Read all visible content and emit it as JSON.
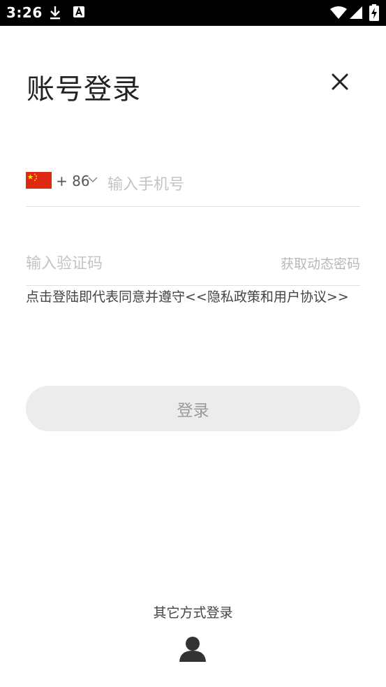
{
  "status_bar": {
    "time": "3:26",
    "left_icons": [
      "download-icon",
      "a-app-icon"
    ],
    "right_icons": [
      "wifi-icon",
      "signal-icon",
      "battery-charging-icon"
    ]
  },
  "header": {
    "title": "账号登录",
    "close_icon": "close-icon"
  },
  "phone": {
    "flag_icon": "china-flag-icon",
    "country_code": "+ 86",
    "placeholder": "输入手机号",
    "value": ""
  },
  "verification": {
    "placeholder": "输入验证码",
    "value": "",
    "get_code_label": "获取动态密码"
  },
  "agreement_text": "点击登陆即代表同意并遵守<<隐私政策和用户协议>>",
  "login_button": "登录",
  "other_login": {
    "title": "其它方式登录",
    "icon": "user-icon"
  },
  "colors": {
    "status_bar_bg": "#000000",
    "title_text": "#222222",
    "placeholder": "#c4c4c4",
    "button_bg": "#ececec",
    "button_text": "#9a9a9a",
    "flag_red": "#de2910",
    "flag_yellow": "#ffde00"
  }
}
